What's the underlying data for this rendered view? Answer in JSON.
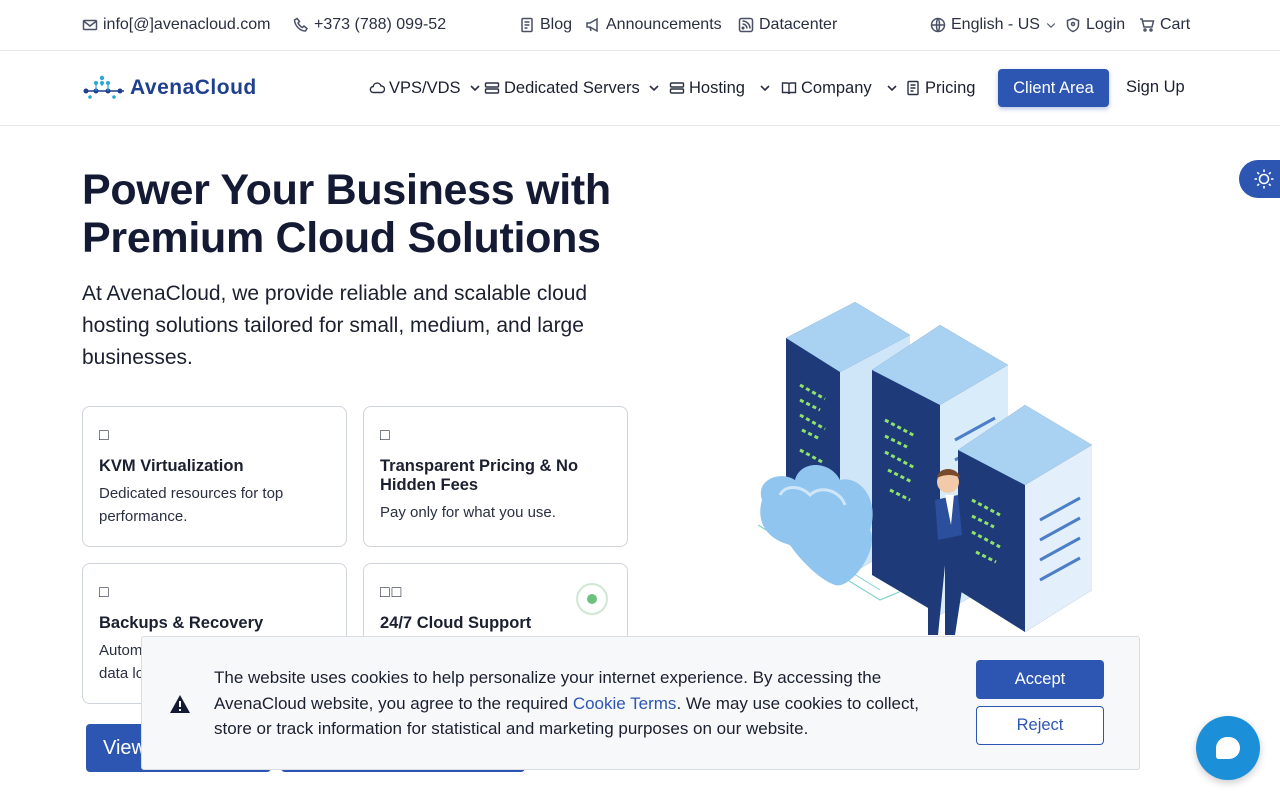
{
  "topbar": {
    "email": "info[@]avenacloud.com",
    "phone": "+373 (788) 099-52",
    "blog": "Blog",
    "announcements": "Announcements",
    "datacenter": "Datacenter",
    "language": "English - US",
    "login": "Login",
    "cart": "Cart"
  },
  "nav": {
    "logo": "AvenaCloud",
    "items": [
      "VPS/VDS",
      "Dedicated Servers",
      "Hosting",
      "Company",
      "Pricing"
    ],
    "client_area": "Client Area",
    "sign_up": "Sign Up"
  },
  "hero": {
    "title": "Power Your Business with Premium Cloud Solutions",
    "subtitle": "At AvenaCloud, we provide reliable and scalable cloud hosting solutions tailored for small, medium, and large businesses.",
    "cards": [
      {
        "icon": "□",
        "title": "KVM Virtualization",
        "desc": "Dedicated resources for top performance."
      },
      {
        "icon": "□",
        "title": "Transparent Pricing & No Hidden Fees",
        "desc": "Pay only for what you use."
      },
      {
        "icon": "□",
        "title": "Backups & Recovery",
        "desc": "Autom"
      },
      {
        "icon": "□□",
        "title": "24/7 Cloud Support",
        "desc": ""
      }
    ],
    "cta_primary": "View",
    "card3_line2": "data lo"
  },
  "cookie": {
    "text_before": "The website uses cookies to help personalize your internet experience. By accessing the AvenaCloud website, you agree to the required ",
    "link": "Cookie Terms",
    "text_after": ". We may use cookies to collect, store or track information for statistical and marketing purposes on our website.",
    "accept": "Accept",
    "reject": "Reject"
  },
  "colors": {
    "primary": "#2d56b3",
    "chat": "#1c8fd9",
    "accent_green": "#6cc17e"
  }
}
